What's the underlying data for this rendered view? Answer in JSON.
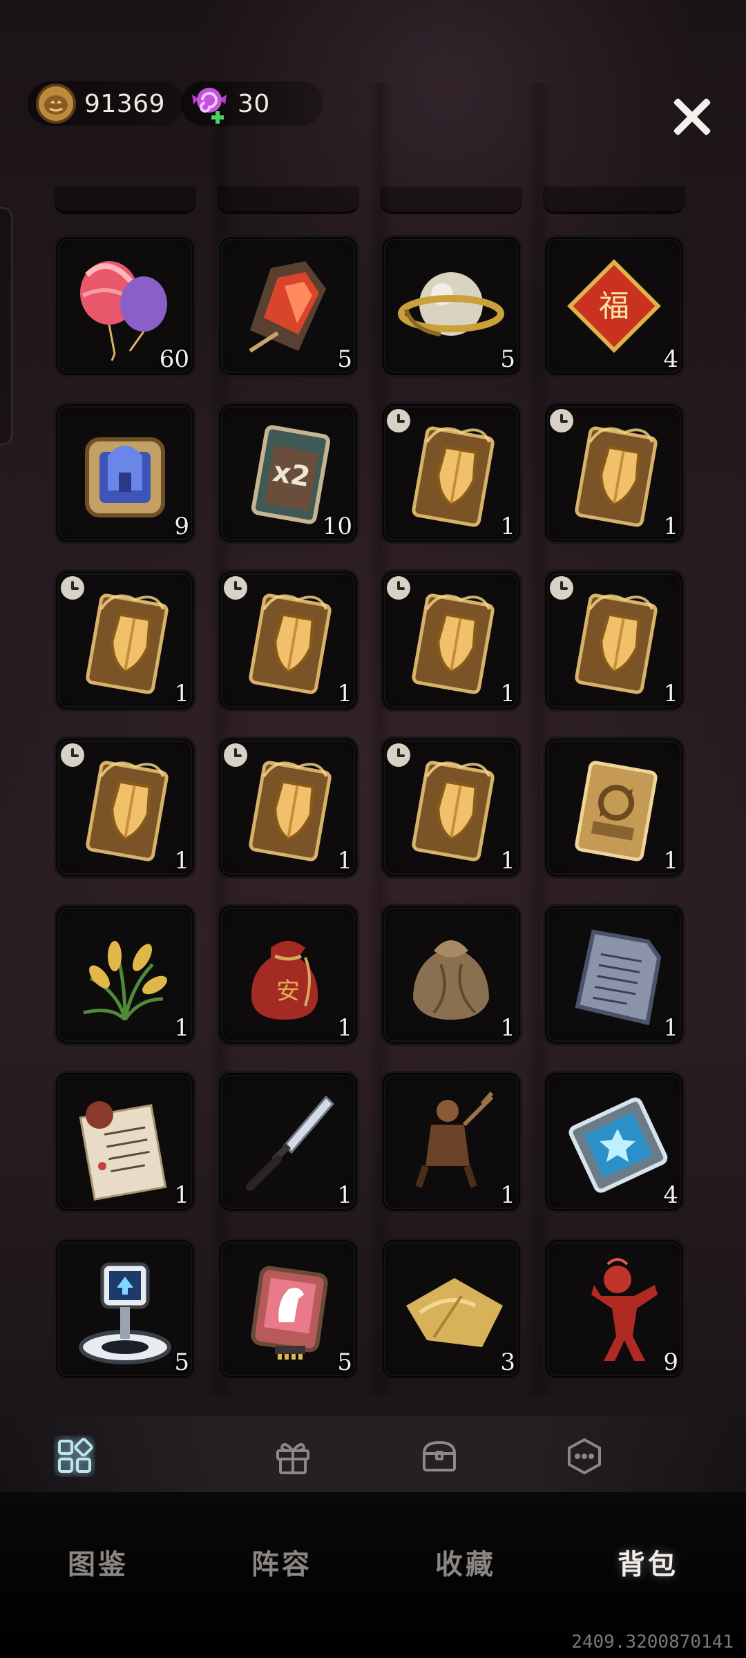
{
  "currency": {
    "gold": "91369",
    "candy": "30"
  },
  "items": [
    {
      "icon": "balloon-icon",
      "qty": "60",
      "timed": false
    },
    {
      "icon": "red-gem-icon",
      "qty": "5",
      "timed": false
    },
    {
      "icon": "golden-orb-icon",
      "qty": "5",
      "timed": false
    },
    {
      "icon": "fu-charm-icon",
      "qty": "4",
      "timed": false
    },
    {
      "icon": "blue-lantern-card-icon",
      "qty": "9",
      "timed": false
    },
    {
      "icon": "x2-card-icon",
      "qty": "10",
      "timed": false
    },
    {
      "icon": "shield-card-icon",
      "qty": "1",
      "timed": true
    },
    {
      "icon": "shield-card-icon",
      "qty": "1",
      "timed": true
    },
    {
      "icon": "shield-card-icon",
      "qty": "1",
      "timed": true
    },
    {
      "icon": "shield-card-icon",
      "qty": "1",
      "timed": true
    },
    {
      "icon": "shield-card-icon",
      "qty": "1",
      "timed": true
    },
    {
      "icon": "shield-card-icon",
      "qty": "1",
      "timed": true
    },
    {
      "icon": "shield-card-icon",
      "qty": "1",
      "timed": true
    },
    {
      "icon": "shield-card-icon",
      "qty": "1",
      "timed": true
    },
    {
      "icon": "shield-card-icon",
      "qty": "1",
      "timed": true
    },
    {
      "icon": "refresh-card-icon",
      "qty": "1",
      "timed": false
    },
    {
      "icon": "rice-sheaf-icon",
      "qty": "1",
      "timed": false
    },
    {
      "icon": "red-pouch-icon",
      "qty": "1",
      "timed": false
    },
    {
      "icon": "cloth-bundle-icon",
      "qty": "1",
      "timed": false
    },
    {
      "icon": "stone-tablet-icon",
      "qty": "1",
      "timed": false
    },
    {
      "icon": "contract-paper-icon",
      "qty": "1",
      "timed": false
    },
    {
      "icon": "dagger-icon",
      "qty": "1",
      "timed": false
    },
    {
      "icon": "figure-statue-icon",
      "qty": "1",
      "timed": false
    },
    {
      "icon": "crystal-card-icon",
      "qty": "4",
      "timed": false
    },
    {
      "icon": "robot-device-icon",
      "qty": "5",
      "timed": false
    },
    {
      "icon": "horse-badge-icon",
      "qty": "5",
      "timed": false
    },
    {
      "icon": "gold-cloth-icon",
      "qty": "3",
      "timed": false
    },
    {
      "icon": "red-doll-icon",
      "qty": "9",
      "timed": false
    }
  ],
  "subtabs": [
    {
      "icon": "grid-icon",
      "active": true
    },
    {
      "icon": "gift-icon",
      "active": false
    },
    {
      "icon": "chest-icon",
      "active": false
    },
    {
      "icon": "more-icon",
      "active": false
    }
  ],
  "nav": {
    "catalog": "图鉴",
    "lineup": "阵容",
    "collection": "收藏",
    "backpack": "背包"
  },
  "build": "2409.3200870141"
}
